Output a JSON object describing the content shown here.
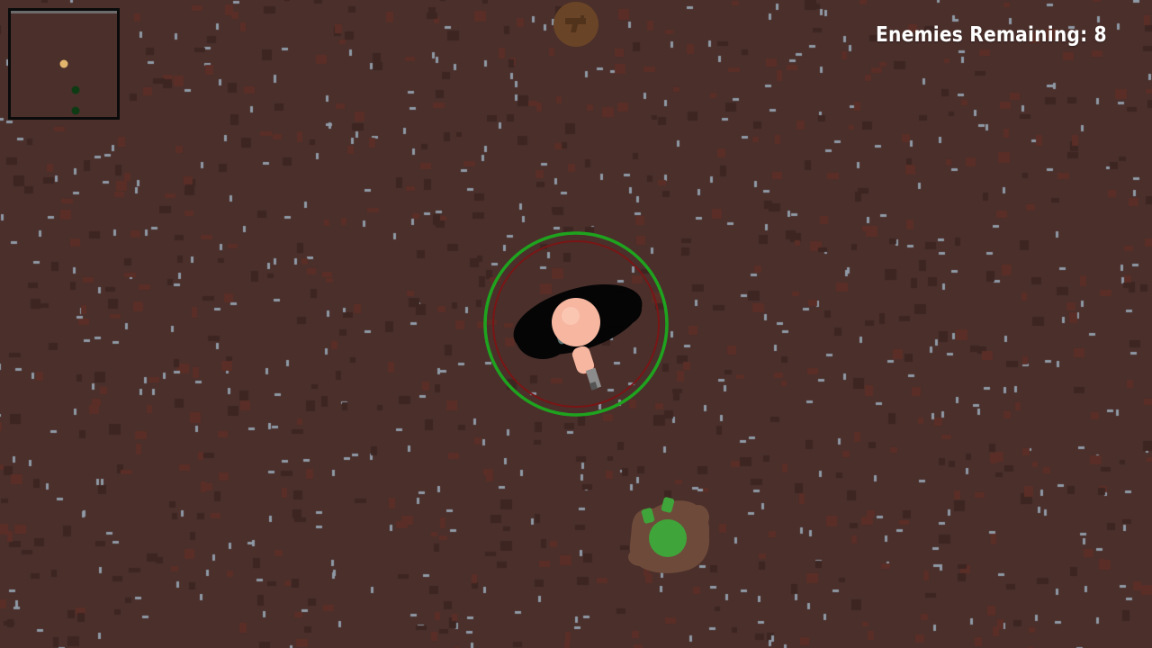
{
  "hud": {
    "enemies_remaining_label": "Enemies Remaining:",
    "enemies_remaining_count": "8",
    "enemies_remaining_text": "Enemies Remaining: 8"
  },
  "minimap": {
    "player_marker_color": "#e2b56c",
    "enemy_marker_color": "#0f3b14",
    "border_color": "#0b0b0b"
  },
  "player": {
    "skin_color": "#f6b6a0",
    "shadow_color": "#050505",
    "weapon_color": "#8c8c8c",
    "ring_outer_color": "#1fa31f",
    "ring_inner_color": "#7a1515"
  },
  "enemy": {
    "type": "zombie",
    "body_color": "#3fa43a",
    "blood_color": "#6e4a3a"
  },
  "pickup": {
    "icon": "pistol-icon",
    "bg_color": "#6a4426"
  },
  "colors": {
    "ground": "#4a2f2b",
    "speckle_light": "#8f9aa6",
    "speckle_dark": "#3d2522",
    "speckle_rust": "#5a2e26"
  }
}
